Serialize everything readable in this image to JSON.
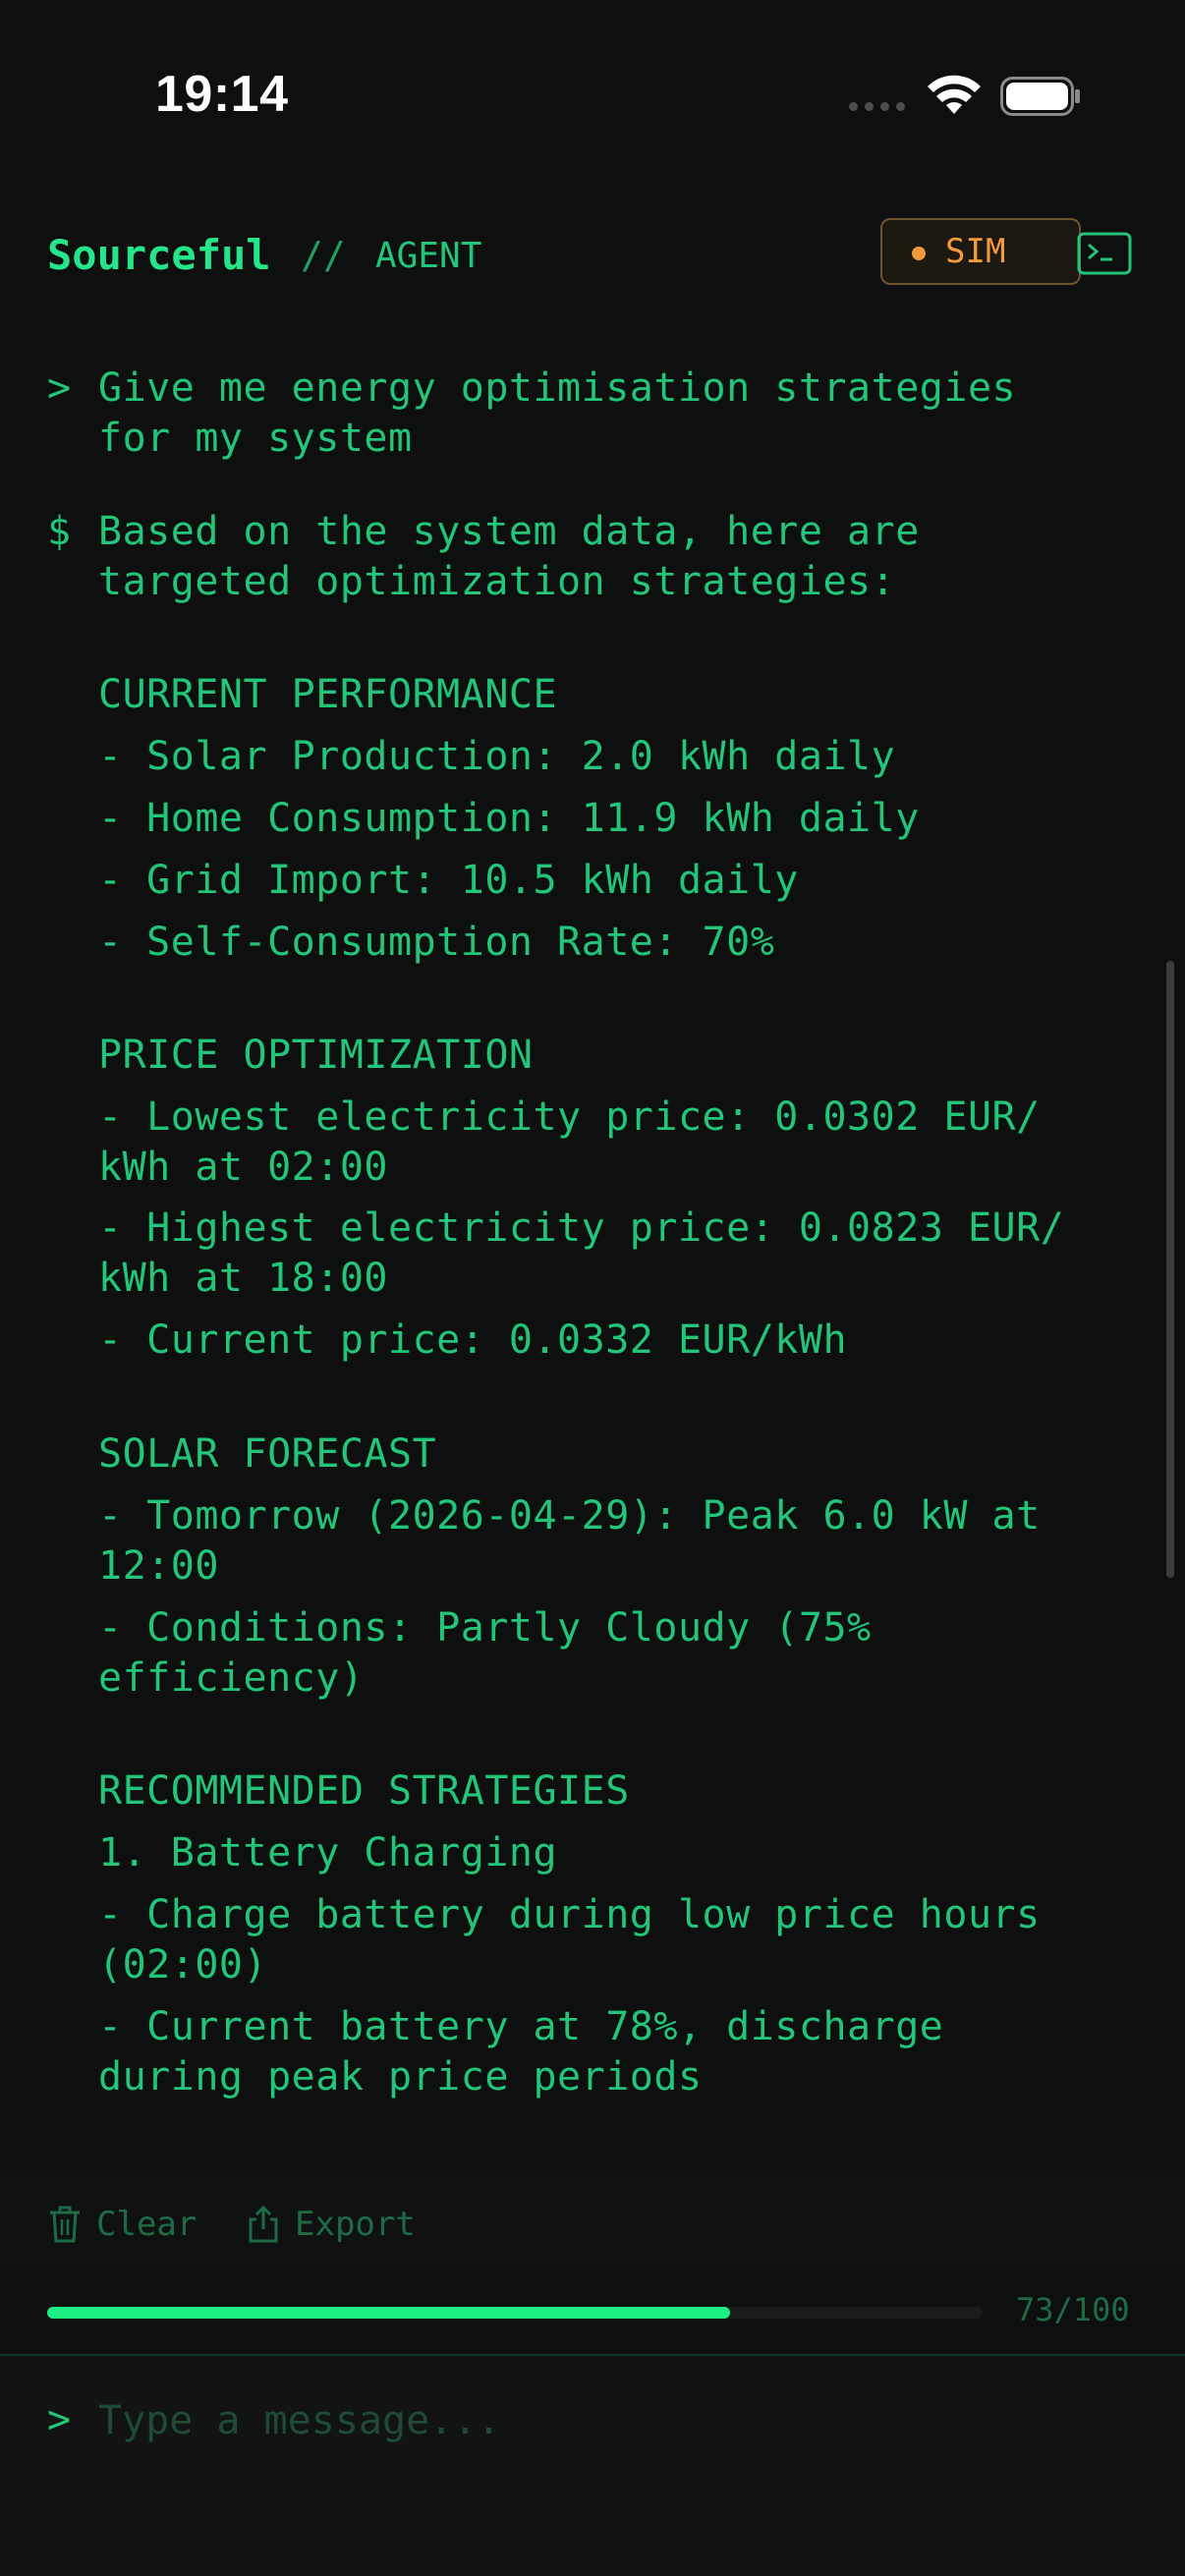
{
  "status": {
    "time": "19:14"
  },
  "header": {
    "brand": "Sourceful",
    "separator": "//",
    "subtitle": "AGENT",
    "badge": "SIM"
  },
  "user_prompt": {
    "marker": ">",
    "lines": [
      "Give me energy optimisation strategies",
      "for my system"
    ]
  },
  "response": {
    "marker": "$",
    "intro": [
      "Based on the system data, here are",
      "targeted optimization strategies:"
    ],
    "sections": {
      "current": {
        "title": "CURRENT PERFORMANCE",
        "items": [
          "- Solar Production: 2.0 kWh daily",
          "- Home Consumption: 11.9 kWh daily",
          "- Grid Import: 10.5 kWh daily",
          "- Self-Consumption Rate: 70%"
        ]
      },
      "price": {
        "title": "PRICE OPTIMIZATION",
        "items": [
          "- Lowest electricity price: 0.0302 EUR/",
          "kWh at 02:00",
          "- Highest electricity price: 0.0823 EUR/",
          "kWh at 18:00",
          "- Current price: 0.0332 EUR/kWh"
        ]
      },
      "forecast": {
        "title": "SOLAR FORECAST",
        "items": [
          "- Tomorrow (2026-04-29): Peak 6.0 kW at",
          "12:00",
          "- Conditions: Partly Cloudy (75%",
          "efficiency)"
        ]
      },
      "strategies": {
        "title": "RECOMMENDED STRATEGIES",
        "items": [
          "1. Battery Charging",
          "- Charge battery during low price hours",
          "(02:00)",
          "- Current battery at 78%, discharge",
          "during peak price periods"
        ]
      }
    }
  },
  "toolbar": {
    "clear": "Clear",
    "export": "Export"
  },
  "progress": {
    "label": "73/100",
    "value": 0.73
  },
  "composer": {
    "marker": ">",
    "placeholder": "Type a message..."
  },
  "colors": {
    "accent": "#24e58a",
    "text": "#22c57a",
    "sim": "#f29a3c",
    "background": "#0e0f0f"
  }
}
